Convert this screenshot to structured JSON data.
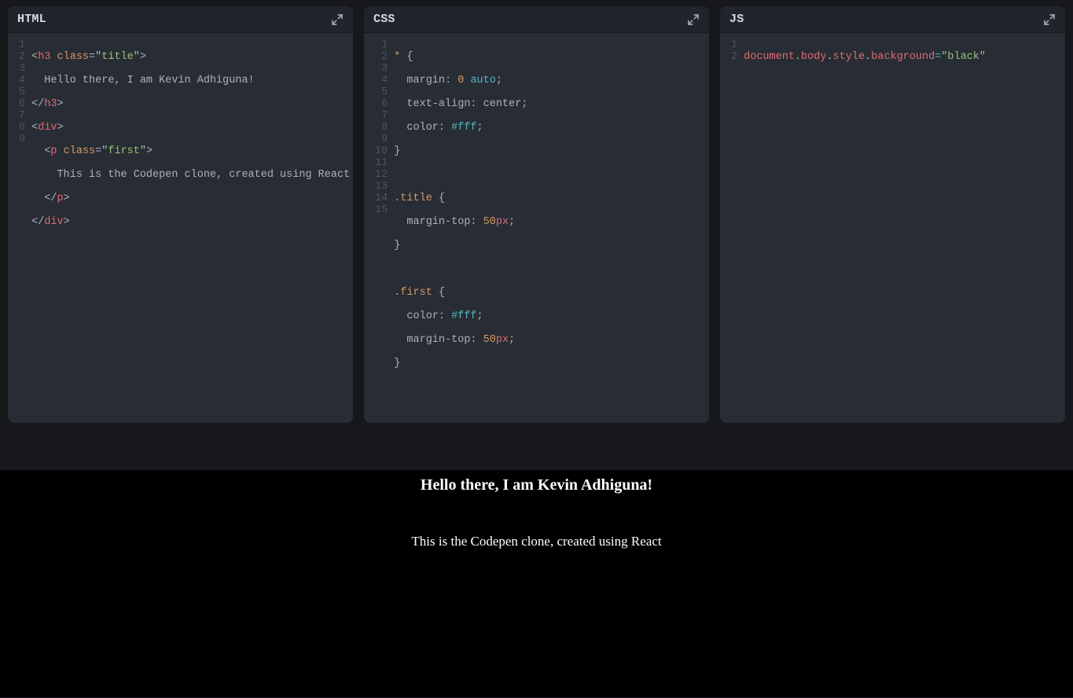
{
  "panes": {
    "html": {
      "title": "HTML",
      "lines": 9,
      "code": {
        "l1": {
          "open": "<",
          "tag": "h3",
          "sp": " ",
          "attr": "class",
          "eq": "=",
          "q1": "\"",
          "val": "title",
          "q2": "\"",
          "close": ">"
        },
        "l2": "  Hello there, I am Kevin Adhiguna!",
        "l3": {
          "open": "</",
          "tag": "h3",
          "close": ">"
        },
        "l4": {
          "open": "<",
          "tag": "div",
          "close": ">"
        },
        "l5": {
          "indent": "  ",
          "open": "<",
          "tag": "p",
          "sp": " ",
          "attr": "class",
          "eq": "=",
          "q1": "\"",
          "val": "first",
          "q2": "\"",
          "close": ">"
        },
        "l6": "    This is the Codepen clone, created using React",
        "l7": {
          "indent": "  ",
          "open": "</",
          "tag": "p",
          "close": ">"
        },
        "l8": {
          "open": "</",
          "tag": "div",
          "close": ">"
        }
      }
    },
    "css": {
      "title": "CSS",
      "lines": 15,
      "code": {
        "l1": {
          "sel": "* ",
          "brace": "{"
        },
        "l2": {
          "indent": "  ",
          "prop": "margin",
          "colon": ": ",
          "num": "0",
          "sp": " ",
          "val2": "auto",
          "semi": ";"
        },
        "l3": {
          "indent": "  ",
          "prop": "text-align",
          "colon": ": ",
          "val": "center",
          "semi": ";"
        },
        "l4": {
          "indent": "  ",
          "prop": "color",
          "colon": ": ",
          "hash": "#",
          "hex": "fff",
          "semi": ";"
        },
        "l5": {
          "brace": "}"
        },
        "l6": "",
        "l7": {
          "sel": ".title ",
          "brace": "{"
        },
        "l8": {
          "indent": "  ",
          "prop": "margin-top",
          "colon": ": ",
          "num": "50",
          "unit": "px",
          "semi": ";"
        },
        "l9": {
          "brace": "}"
        },
        "l10": "",
        "l11": {
          "sel": ".first ",
          "brace": "{"
        },
        "l12": {
          "indent": "  ",
          "prop": "color",
          "colon": ": ",
          "hash": "#",
          "hex": "fff",
          "semi": ";"
        },
        "l13": {
          "indent": "  ",
          "prop": "margin-top",
          "colon": ": ",
          "num": "50",
          "unit": "px",
          "semi": ";"
        },
        "l14": {
          "brace": "}"
        }
      }
    },
    "js": {
      "title": "JS",
      "lines": 2,
      "code": {
        "l1": {
          "a": "document",
          "d1": ".",
          "b": "body",
          "d2": ".",
          "c": "style",
          "d3": ".",
          "d": "background",
          "eq": "=",
          "q1": "\"",
          "val": "black",
          "q2": "\""
        }
      }
    }
  },
  "output": {
    "heading": "Hello there, I am Kevin Adhiguna!",
    "paragraph": "This is the Codepen clone, created using React"
  }
}
